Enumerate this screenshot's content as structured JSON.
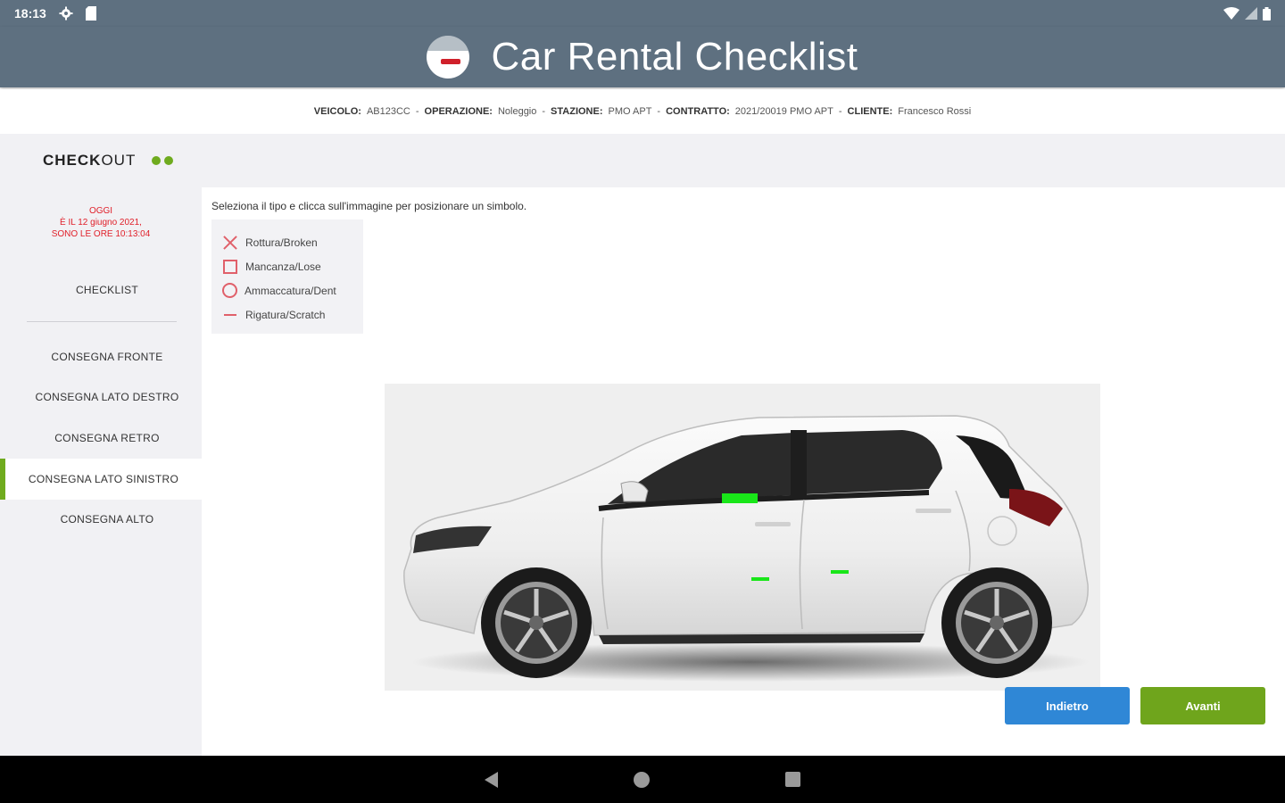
{
  "status_bar": {
    "time": "18:13"
  },
  "app": {
    "title": "Car Rental Checklist"
  },
  "info": {
    "vehicle_label": "VEICOLO:",
    "vehicle_value": "AB123CC",
    "operation_label": "OPERAZIONE:",
    "operation_value": "Noleggio",
    "station_label": "STAZIONE:",
    "station_value": "PMO APT",
    "contract_label": "CONTRATTO:",
    "contract_value": "2021/20019 PMO APT",
    "client_label": "CLIENTE:",
    "client_value": "Francesco Rossi",
    "separator": "-"
  },
  "sidebar": {
    "checkout_bold": "CHECK",
    "checkout_light": "OUT",
    "date_line1": "OGGI",
    "date_line2": "È IL 12 giugno 2021,",
    "date_line3": "SONO LE ORE 10:13:04",
    "checklist_label": "CHECKLIST",
    "items": [
      {
        "label": "CONSEGNA FRONTE"
      },
      {
        "label": "CONSEGNA LATO DESTRO"
      },
      {
        "label": "CONSEGNA RETRO"
      },
      {
        "label": "CONSEGNA LATO SINISTRO"
      },
      {
        "label": "CONSEGNA ALTO"
      }
    ]
  },
  "main": {
    "instruction": "Seleziona il tipo e clicca sull'immagine per posizionare un simbolo.",
    "legend": [
      {
        "icon": "x-icon",
        "label": "Rottura/Broken"
      },
      {
        "icon": "square-icon",
        "label": "Mancanza/Lose"
      },
      {
        "icon": "circle-icon",
        "label": "Ammaccatura/Dent"
      },
      {
        "icon": "dash-icon",
        "label": "Rigatura/Scratch"
      }
    ],
    "marker_color": "#19e619",
    "symbol_color": "#e0606a"
  },
  "buttons": {
    "back": "Indietro",
    "next": "Avanti"
  },
  "colors": {
    "appbar": "#5e7080",
    "accent_green": "#6fab1e",
    "button_blue": "#2f87d6",
    "date_red": "#e0202a"
  }
}
